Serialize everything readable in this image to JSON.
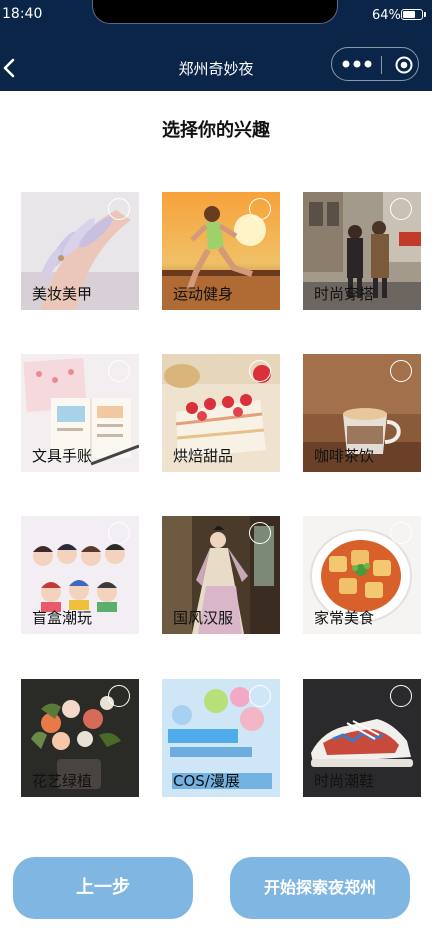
{
  "status_bar": {
    "time": "18:40",
    "battery": "64%"
  },
  "nav": {
    "title": "郑州奇妙夜"
  },
  "heading": "选择你的兴趣",
  "interests": [
    {
      "label": "美妆美甲"
    },
    {
      "label": "运动健身"
    },
    {
      "label": "时尚穿搭"
    },
    {
      "label": "文具手账"
    },
    {
      "label": "烘焙甜品"
    },
    {
      "label": "咖啡茶饮"
    },
    {
      "label": "盲盒潮玩"
    },
    {
      "label": "国风汉服"
    },
    {
      "label": "家常美食"
    },
    {
      "label": "花艺绿植"
    },
    {
      "label": "COS/漫展"
    },
    {
      "label": "时尚潮鞋"
    }
  ],
  "buttons": {
    "prev": "上一步",
    "start": "开始探索夜郑州"
  },
  "colors": {
    "nav_bg": "#0b2548",
    "button_bg": "#7fb6e2"
  }
}
